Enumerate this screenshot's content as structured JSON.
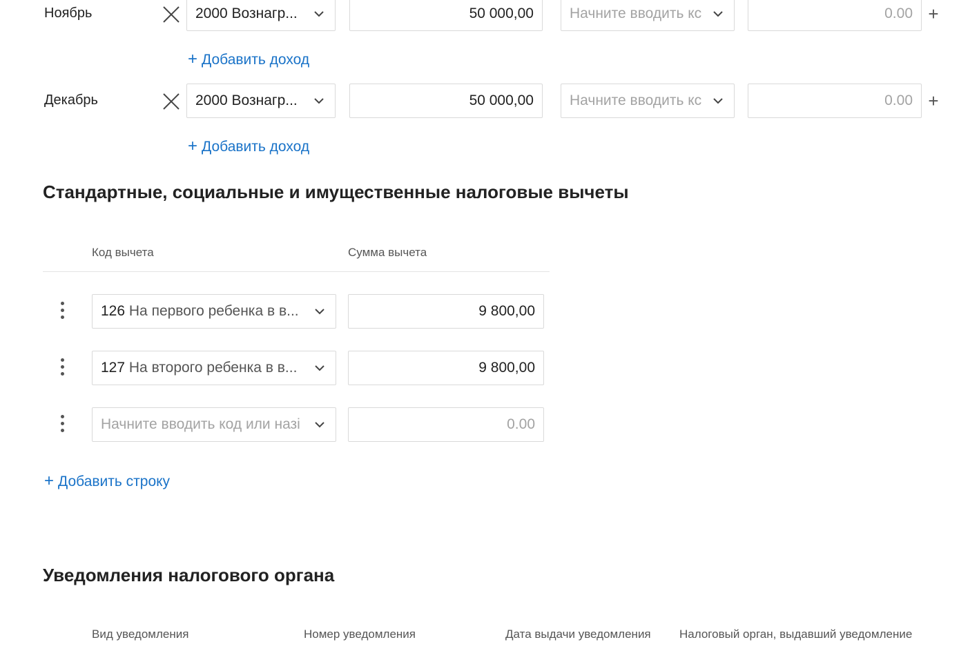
{
  "income_rows": [
    {
      "month": "Ноябрь",
      "income_code": "2000 Вознагр...",
      "amount": "50 000,00",
      "deduction_placeholder": "Начните вводить кс",
      "deduction_amount": "0.00",
      "add_income_label": "Добавить доход"
    },
    {
      "month": "Декабрь",
      "income_code": "2000 Вознагр...",
      "amount": "50 000,00",
      "deduction_placeholder": "Начните вводить кс",
      "deduction_amount": "0.00",
      "add_income_label": "Добавить доход"
    }
  ],
  "deductions": {
    "title": "Стандартные, социальные и имущественные налоговые вычеты",
    "columns": {
      "code": "Код вычета",
      "amount": "Сумма вычета"
    },
    "rows": [
      {
        "code": "126",
        "desc": "На первого ребенка в в...",
        "amount": "9 800,00"
      },
      {
        "code": "127",
        "desc": "На второго ребенка в в...",
        "amount": "9 800,00"
      }
    ],
    "empty_row": {
      "placeholder": "Начните вводить код или назі",
      "amount_placeholder": "0.00"
    },
    "add_row_label": "Добавить строку"
  },
  "notifications": {
    "title": "Уведомления налогового органа",
    "columns": {
      "type": "Вид уведомления",
      "number": "Номер уведомления",
      "date": "Дата выдачи уведомления",
      "authority": "Налоговый орган, выдавший уведомление"
    }
  },
  "icons": {
    "remove": "close-icon",
    "dropdown": "chevron-down-icon",
    "add": "plus-icon",
    "row_menu": "vertical-dots-icon"
  },
  "colors": {
    "link": "#1a73c8",
    "border": "#d9d9d9",
    "placeholder": "#a3a3a3",
    "text": "#222222"
  }
}
